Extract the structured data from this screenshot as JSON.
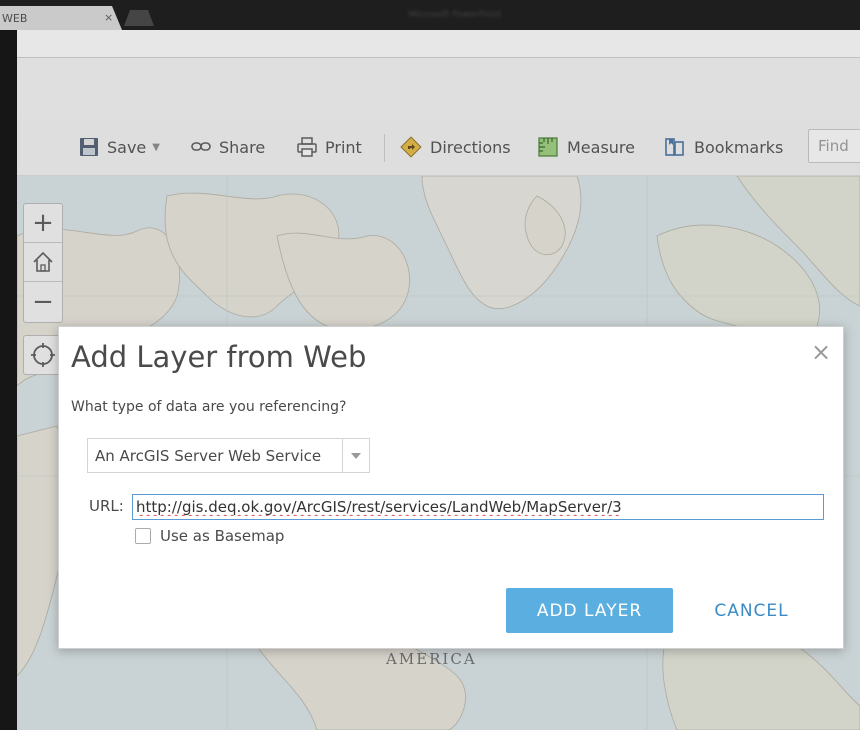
{
  "browser": {
    "tab_title": "WEB",
    "tab_close": "×",
    "window_title": "Microsoft PowerPoint"
  },
  "toolbar": {
    "save_label": "Save",
    "share_label": "Share",
    "print_label": "Print",
    "directions_label": "Directions",
    "measure_label": "Measure",
    "bookmarks_label": "Bookmarks",
    "find_placeholder": "Find"
  },
  "map": {
    "zoom_in": "+",
    "zoom_out": "−",
    "label_america": "AMERICA"
  },
  "dialog": {
    "title": "Add Layer from Web",
    "close": "×",
    "question": "What type of data are you referencing?",
    "type_selected": "An ArcGIS Server Web Service",
    "url_label": "URL:",
    "url_value": "http://gis.deq.ok.gov/ArcGIS/rest/services/LandWeb/MapServer/3",
    "basemap_label": "Use as Basemap",
    "add_button": "ADD LAYER",
    "cancel_button": "CANCEL"
  },
  "colors": {
    "accent": "#5baee0",
    "link": "#3a8bc6",
    "text": "#4a4a4a"
  }
}
